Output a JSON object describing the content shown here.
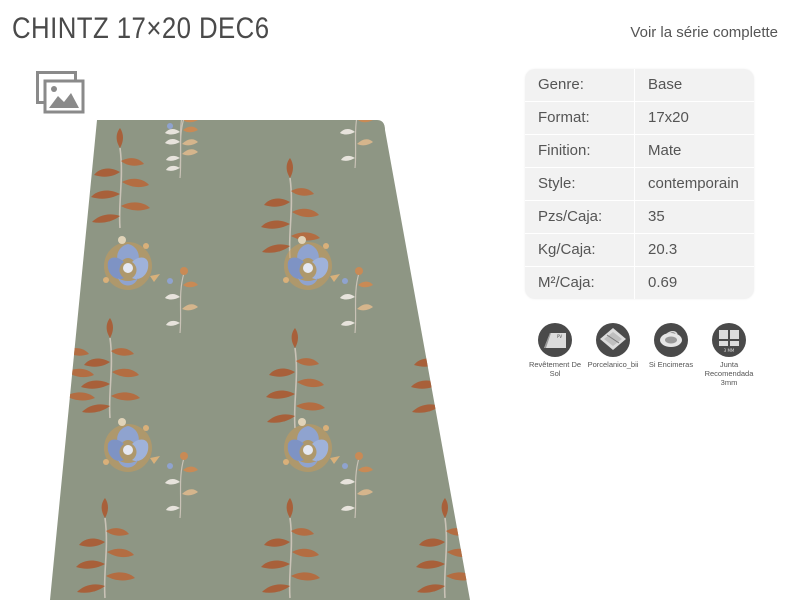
{
  "product": {
    "title": "CHINTZ 17×20 DEC6",
    "series_link": "Voir la série complette"
  },
  "specs": [
    {
      "key": "Genre:",
      "value": "Base"
    },
    {
      "key": "Format:",
      "value": "17x20"
    },
    {
      "key": "Finition:",
      "value": "Mate"
    },
    {
      "key": "Style:",
      "value": "contemporain"
    },
    {
      "key": "Pzs/Caja:",
      "value": "35"
    },
    {
      "key": "Kg/Caja:",
      "value": "20.3"
    },
    {
      "key": "M²/Caja:",
      "value": "0.69"
    }
  ],
  "features": [
    {
      "icon": "floor-tile-icon",
      "label": "Revêtement De Sol",
      "icon_text": "PV"
    },
    {
      "icon": "porcelain-tile-icon",
      "label": "Porcelanico_bii",
      "icon_text": ""
    },
    {
      "icon": "no-countertops-icon",
      "label": "Si Encimeras",
      "icon_text": ""
    },
    {
      "icon": "grout-joint-icon",
      "label": "Junta Recomendada 3mm",
      "icon_text": "3 MM"
    }
  ],
  "colors": {
    "tile_background": "#8e9684",
    "leaf": "#a8603a",
    "flower_blue": "#8fa3cf",
    "flower_gold": "#c99a5a",
    "spec_bg": "#f2f2f2",
    "text": "#555555"
  }
}
